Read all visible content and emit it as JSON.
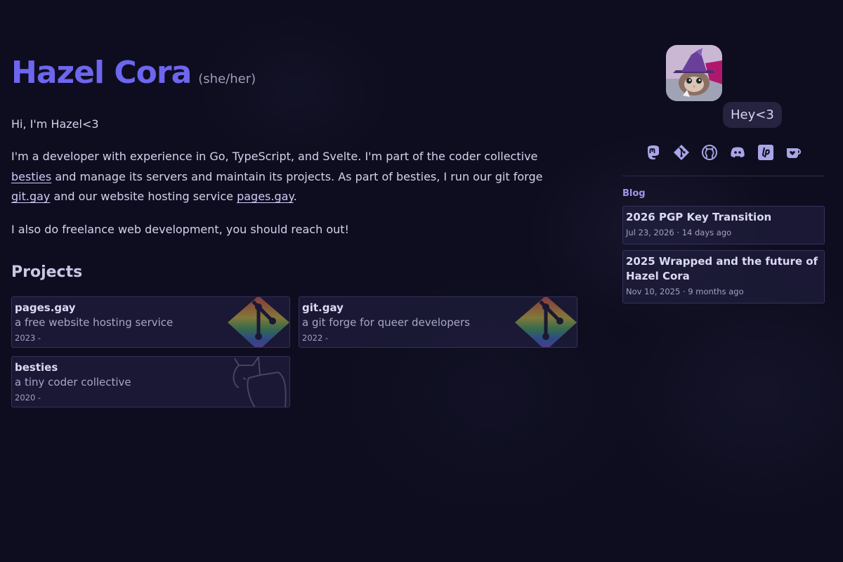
{
  "header": {
    "name": "Hazel Cora",
    "pronouns": "(she/her)"
  },
  "intro": {
    "greeting": "Hi, I'm Hazel<3",
    "p1_a": "I'm a developer with experience in Go, TypeScript, and Svelte. I'm part of the coder collective ",
    "link_besties": "besties",
    "p1_b": " and manage its servers and maintain its projects. As part of besties, I run our git forge ",
    "link_gitgay": "git.gay",
    "p1_c": " and our website hosting service ",
    "link_pagesgay": "pages.gay",
    "p1_d": ".",
    "p2": "I also do freelance web development, you should reach out!"
  },
  "projects": {
    "heading": "Projects",
    "items": [
      {
        "title": "pages.gay",
        "description": "a free website hosting service",
        "years": "2023 -",
        "icon": "git-rainbow-icon"
      },
      {
        "title": "git.gay",
        "description": "a git forge for queer developers",
        "years": "2022 -",
        "icon": "git-rainbow-icon"
      },
      {
        "title": "besties",
        "description": "a tiny coder collective",
        "years": "2020 -",
        "icon": "cat-outline-icon"
      }
    ]
  },
  "sidebar": {
    "avatar": "kitten-witch-avatar",
    "bubble": "Hey<3",
    "socials": [
      {
        "icon": "mastodon-icon"
      },
      {
        "icon": "git-icon"
      },
      {
        "icon": "github-icon"
      },
      {
        "icon": "discord-icon"
      },
      {
        "icon": "liberapay-icon"
      },
      {
        "icon": "kofi-icon"
      }
    ],
    "blog_heading": "Blog",
    "posts": [
      {
        "title": "2026 PGP Key Transition",
        "meta": "Jul 23, 2026 · 14 days ago"
      },
      {
        "title": "2025 Wrapped and the future of Hazel Cora",
        "meta": "Nov 10, 2025 · 9 months ago"
      }
    ]
  },
  "colors": {
    "background": "#0e0d1f",
    "accent": "#6e66ef",
    "text": "#d4d2ec",
    "card_border": "#35325a"
  }
}
